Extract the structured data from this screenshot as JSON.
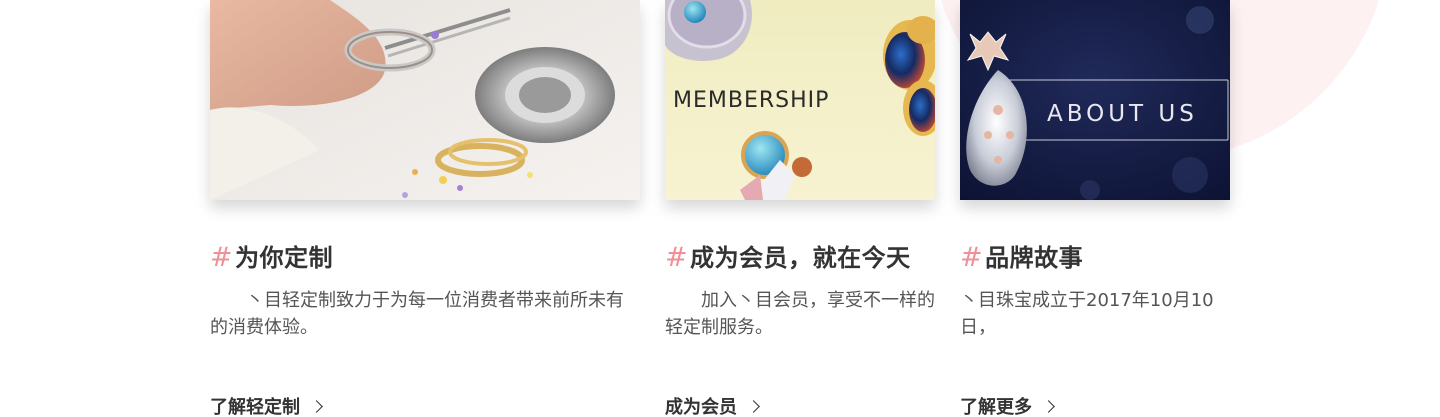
{
  "cards": [
    {
      "hash": "#",
      "title": "为你定制",
      "description": "　　丶目轻定制致力于为每一位消费者带来前所未有的消费体验。",
      "link_label": "了解轻定制",
      "image_icon": "jewelry-crafting-photo"
    },
    {
      "hash": "#",
      "title": "成为会员，就在今天",
      "description": "　　加入丶目会员，享受不一样的轻定制服务。",
      "link_label": "成为会员",
      "image_text": "MEMBERSHIP",
      "image_icon": "gemstone-jewelry-photo"
    },
    {
      "hash": "#",
      "title": "品牌故事",
      "description": "丶目珠宝成立于2017年10月10日，",
      "link_label": "了解更多",
      "image_text": "ABOUT US",
      "image_icon": "diamond-pendant-photo"
    }
  ],
  "colors": {
    "accent_hash": "#f08f95",
    "background_circle": "#fdf1f1"
  }
}
